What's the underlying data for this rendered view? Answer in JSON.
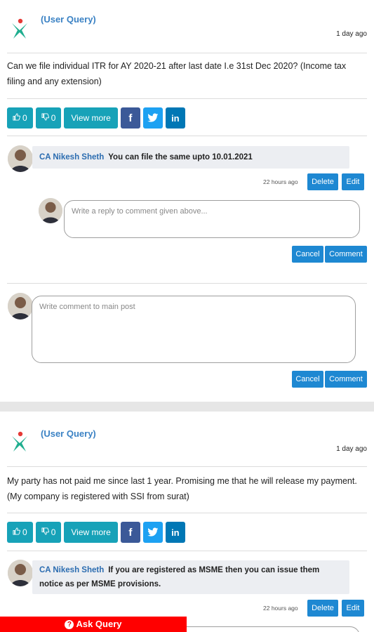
{
  "posts": [
    {
      "tag": "(User Query)",
      "time": "1 day ago",
      "question": "Can we file individual ITR for AY 2020-21 after last date I.e 31st Dec 2020? (Income tax filing and any extension)",
      "likes": "0",
      "dislikes": "0",
      "view_more": "View more",
      "comment": {
        "author": "CA Nikesh Sheth",
        "text": "You can file the same upto 10.01.2021",
        "time": "22 hours ago",
        "delete_label": "Delete",
        "edit_label": "Edit"
      },
      "reply_placeholder": "Write a reply to comment given above...",
      "cancel_label": "Cancel",
      "comment_label": "Comment",
      "main_placeholder": "Write comment to main post"
    },
    {
      "tag": "(User Query)",
      "time": "1 day ago",
      "question": "My party has not paid me since last 1 year. Promising me that he will release my payment. (My company is registered with SSI from surat)",
      "likes": "0",
      "dislikes": "0",
      "view_more": "View more",
      "comment": {
        "author": "CA Nikesh Sheth",
        "text_line1": "If you are registered as MSME then you can issue them",
        "text_line2": "notice as per MSME provisions.",
        "time": "22 hours ago",
        "delete_label": "Delete",
        "edit_label": "Edit"
      }
    }
  ],
  "ask_query_label": "Ask Query",
  "icons": [
    "logo-icon",
    "thumbs-up-icon",
    "thumbs-down-icon",
    "facebook-icon",
    "twitter-icon",
    "linkedin-icon",
    "question-icon"
  ],
  "colors": {
    "teal": "#17a2b8",
    "blue": "#1e88d2",
    "facebook": "#3b5998",
    "twitter": "#1da1f2",
    "linkedin": "#0077b5",
    "ask_bar": "#ff0000"
  }
}
